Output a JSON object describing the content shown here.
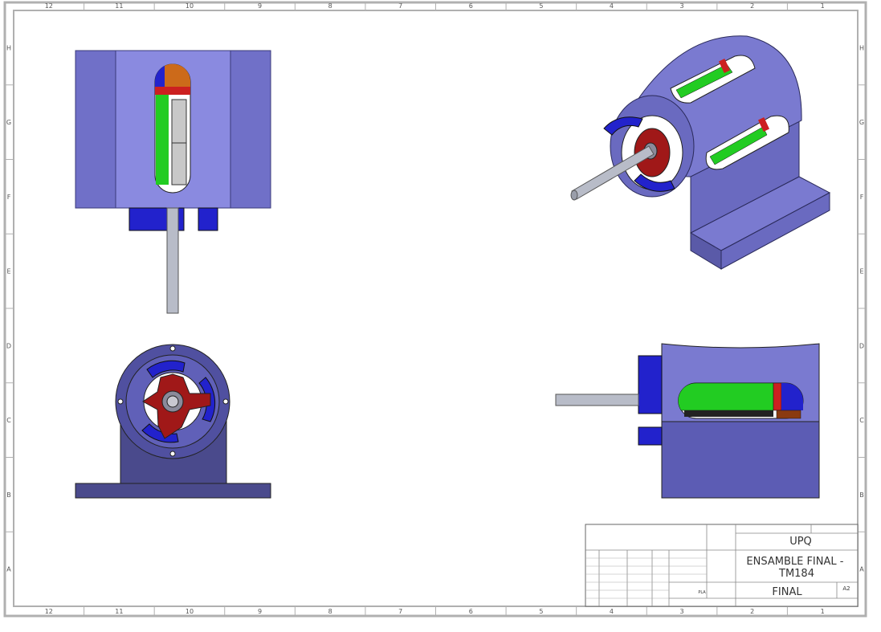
{
  "colors": {
    "body": "#7a7ad0",
    "body_dark": "#5c5cb4",
    "base_dark": "#4a4a8c",
    "blue": "#2222cc",
    "green": "#22cc22",
    "red": "#cc2020",
    "dark_red": "#8a1010",
    "orange": "#cc6a1a",
    "shaft": "#b8bcc8",
    "frame": "#b0b0b0"
  },
  "frame": {
    "columns": [
      "12",
      "11",
      "10",
      "9",
      "8",
      "7",
      "6",
      "5",
      "4",
      "3",
      "2",
      "1"
    ],
    "rows": [
      "H",
      "G",
      "F",
      "E",
      "D",
      "C",
      "B",
      "A"
    ]
  },
  "title_block": {
    "company": "UPQ",
    "drawing_title": "ENSAMBLE FINAL - TM184",
    "revision": "FINAL",
    "sheet_size": "A2",
    "material": "PLA",
    "scale": "",
    "sheet": ""
  }
}
